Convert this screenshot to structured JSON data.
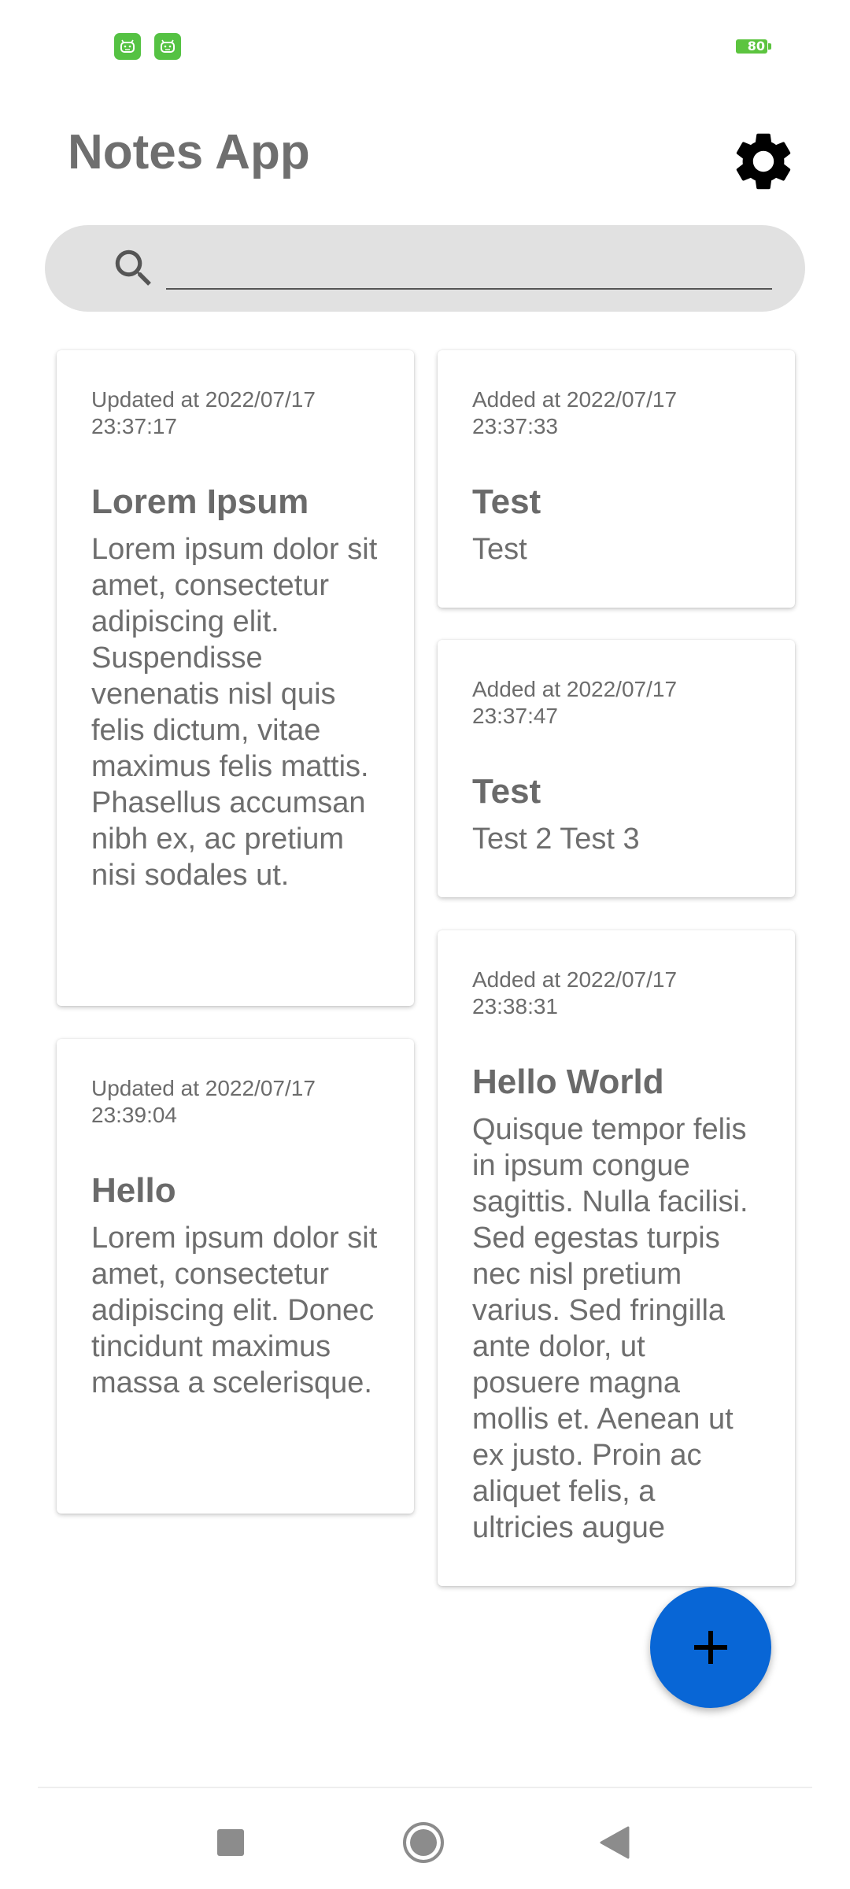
{
  "status_bar": {
    "left_icons": [
      "android-face-icon",
      "android-face-icon"
    ],
    "battery_level": "80",
    "accent_color": "#55c243"
  },
  "header": {
    "title": "Notes App",
    "settings_icon": "gear-icon"
  },
  "search": {
    "icon": "search-icon",
    "value": "",
    "placeholder": ""
  },
  "notes_left": [
    {
      "date": "Updated at 2022/07/17 23:37:17",
      "title": "Lorem Ipsum",
      "body": "Lorem ipsum dolor sit amet, consectetur adipiscing elit. Suspendisse venenatis nisl quis felis dictum, vitae maximus felis mattis. Phasellus accumsan nibh ex, ac pretium nisi sodales ut."
    },
    {
      "date": "Updated at 2022/07/17 23:39:04",
      "title": "Hello",
      "body": "Lorem ipsum dolor sit amet, consectetur adipiscing elit. Donec tincidunt maximus massa a scelerisque."
    }
  ],
  "notes_right": [
    {
      "date": "Added at 2022/07/17 23:37:33",
      "title": "Test",
      "body": "Test"
    },
    {
      "date": "Added at 2022/07/17 23:37:47",
      "title": "Test",
      "body": "Test 2 Test 3"
    },
    {
      "date": "Added at 2022/07/17 23:38:31",
      "title": "Hello World",
      "body": "Quisque tempor felis in ipsum congue sagittis. Nulla facilisi. Sed egestas turpis nec nisl pretium varius. Sed fringilla ante dolor, ut posuere magna mollis et. Aenean ut ex justo. Proin ac aliquet felis, a ultricies augue"
    }
  ],
  "fab": {
    "icon": "plus-icon",
    "color": "#0866d6"
  },
  "nav_bar": {
    "buttons": [
      "recents-square-icon",
      "home-circle-icon",
      "back-triangle-icon"
    ]
  }
}
